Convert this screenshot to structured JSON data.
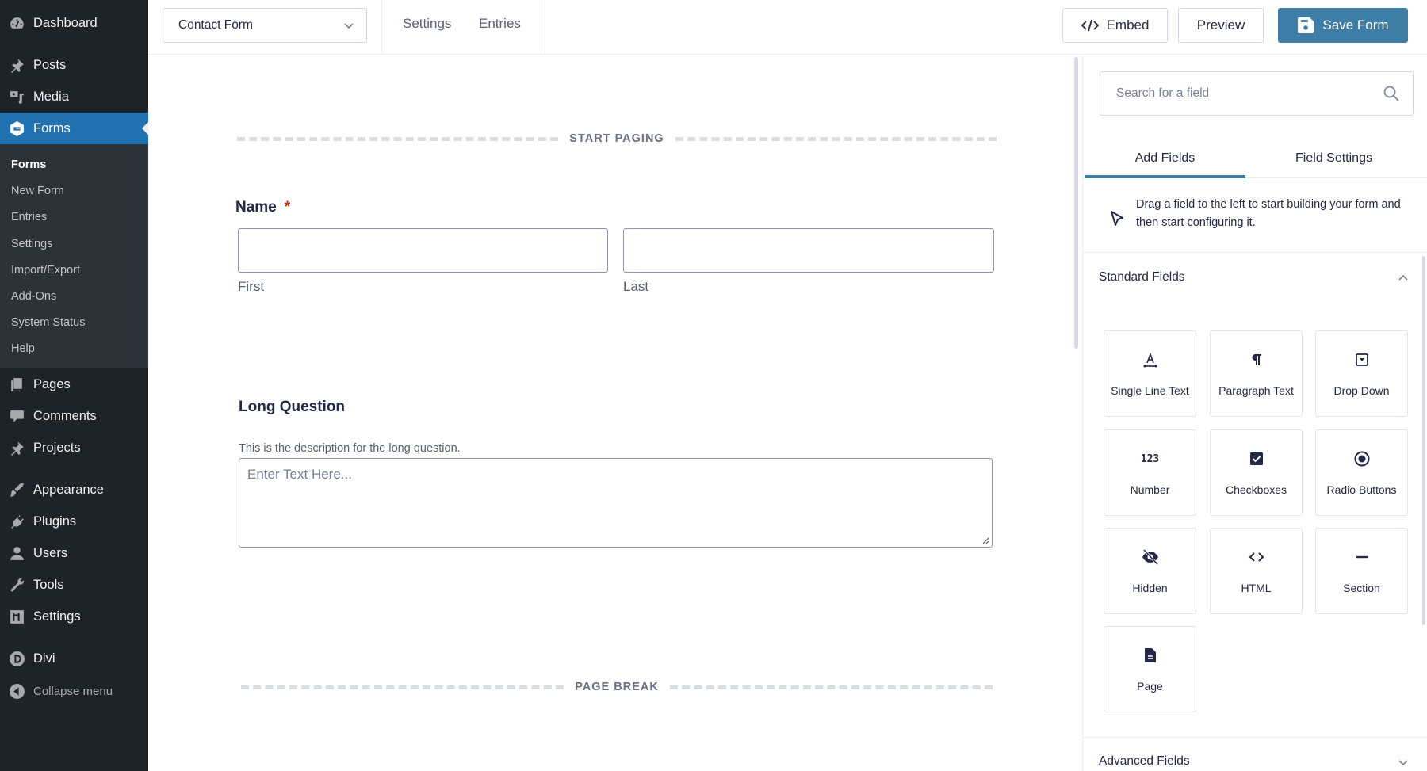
{
  "wp_menu": {
    "items": [
      {
        "label": "Dashboard",
        "icon": "dashboard-icon"
      },
      {
        "label": "Posts",
        "icon": "pushpin-icon"
      },
      {
        "label": "Media",
        "icon": "media-icon"
      },
      {
        "label": "Forms",
        "icon": "gravity-forms-icon",
        "active": true
      },
      {
        "label": "Pages",
        "icon": "pages-icon"
      },
      {
        "label": "Comments",
        "icon": "comment-icon"
      },
      {
        "label": "Projects",
        "icon": "pushpin-icon"
      },
      {
        "label": "Appearance",
        "icon": "paintbrush-icon"
      },
      {
        "label": "Plugins",
        "icon": "plug-icon"
      },
      {
        "label": "Users",
        "icon": "user-icon"
      },
      {
        "label": "Tools",
        "icon": "wrench-icon"
      },
      {
        "label": "Settings",
        "icon": "settings-sliders-icon"
      },
      {
        "label": "Divi",
        "icon": "divi-icon"
      }
    ],
    "submenu": [
      "Forms",
      "New Form",
      "Entries",
      "Settings",
      "Import/Export",
      "Add-Ons",
      "System Status",
      "Help"
    ],
    "submenu_current": "Forms",
    "collapse_label": "Collapse menu"
  },
  "topbar": {
    "form_selector": "Contact Form",
    "links": [
      "Settings",
      "Entries"
    ],
    "embed_label": "Embed",
    "preview_label": "Preview",
    "save_label": "Save Form"
  },
  "canvas": {
    "start_paging_label": "START PAGING",
    "name_field": {
      "label": "Name",
      "required_mark": "*",
      "first_label": "First",
      "last_label": "Last",
      "first_value": "",
      "last_value": ""
    },
    "long_question": {
      "label": "Long Question",
      "description": "This is the description for the long question.",
      "placeholder": "Enter Text Here..."
    },
    "page_break_label": "PAGE BREAK"
  },
  "panel": {
    "search_placeholder": "Search for a field",
    "tabs": [
      {
        "label": "Add Fields",
        "active": true
      },
      {
        "label": "Field Settings",
        "active": false
      }
    ],
    "hint": "Drag a field to the left to start building your form and then start configuring it.",
    "standard_fields_title": "Standard Fields",
    "standard_fields": [
      {
        "label": "Single Line Text",
        "icon": "single-line-text-icon"
      },
      {
        "label": "Paragraph Text",
        "icon": "paragraph-icon"
      },
      {
        "label": "Drop Down",
        "icon": "dropdown-icon"
      },
      {
        "label": "Number",
        "icon": "number-icon"
      },
      {
        "label": "Checkboxes",
        "icon": "checkbox-icon"
      },
      {
        "label": "Radio Buttons",
        "icon": "radio-icon"
      },
      {
        "label": "Hidden",
        "icon": "eye-slash-icon"
      },
      {
        "label": "HTML",
        "icon": "code-icon"
      },
      {
        "label": "Section",
        "icon": "section-icon"
      },
      {
        "label": "Page",
        "icon": "page-icon"
      }
    ],
    "advanced_fields_title": "Advanced Fields"
  },
  "colors": {
    "accent": "#3e7da6",
    "wp_active": "#2271b1",
    "sidebar_bg": "#1d2327",
    "required": "#c02b0a"
  }
}
